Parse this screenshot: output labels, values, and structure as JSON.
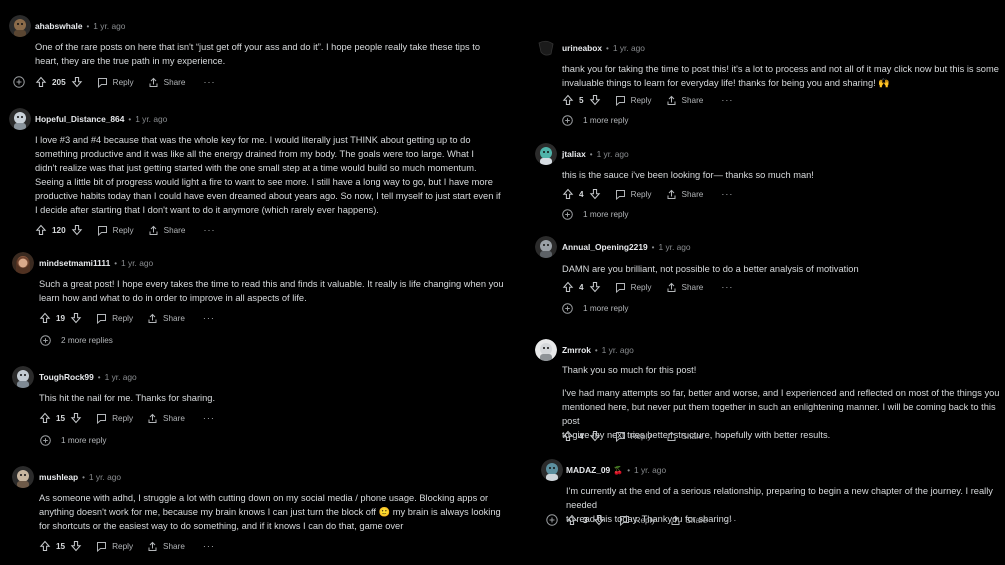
{
  "actions": {
    "reply": "Reply",
    "share": "Share",
    "more": "···"
  },
  "comments": [
    {
      "user": "ahabswhale",
      "time": "1 yr. ago",
      "lines": [
        "One of the rare posts on here that isn't “just get off your ass and do it”. I hope people really take these tips to",
        "heart, they are the true path in my experience."
      ],
      "score": "205",
      "avatar_color": "#8b6b4a"
    },
    {
      "user": "Hopeful_Distance_864",
      "time": "1 yr. ago",
      "lines": [
        "I love #3 and #4 because that was the whole key for me. I would literally just THINK about getting up to do",
        "something productive and it was like all the energy drained from my body. The goals were too large. What I",
        "didn't realize was that just getting started with the one small step at a time would build so much momentum.",
        "Seeing a little bit of progress would light a fire to want to see more. I still have a long way to go, but I have more",
        "productive habits today than I could have even dreamed about years ago. So now, I tell myself to just start even if",
        "I decide after starting that I don't want to do it anymore (which rarely ever happens)."
      ],
      "score": "120",
      "avatar_color": "#c9d1d8"
    },
    {
      "user": "mindsetmami1111",
      "time": "1 yr. ago",
      "lines": [
        "Such a great post! I hope every takes the time to read this and finds it valuable. It really is life changing when you",
        "learn how and what to do in order to improve in all aspects of life."
      ],
      "score": "19",
      "avatar_color": "#a0674a",
      "more_replies": "2 more replies"
    },
    {
      "user": "ToughRock99",
      "time": "1 yr. ago",
      "lines": [
        "This hit the nail for me. Thanks for sharing."
      ],
      "score": "15",
      "avatar_color": "#c3cbd3",
      "more_replies": "1 more reply"
    },
    {
      "user": "mushleap",
      "time": "1 yr. ago",
      "lines": [
        "As someone with adhd, I struggle a lot with cutting down on my social media / phone usage. Blocking apps or",
        "anything doesn't work for me, because my brain knows I can just turn the block off 🙂 my brain is always looking",
        "for shortcuts or the easiest way to do something, and if it knows I can do that, game over"
      ],
      "score": "15",
      "avatar_color": "#6e5a48"
    },
    {
      "user": "urineabox",
      "time": "1 yr. ago",
      "lines": [
        "thank you for taking the time to post this! it's a lot to process and not all of it may click now but this is some",
        "invaluable things to learn for everyday life! thanks for being you and sharing! 🙌"
      ],
      "score": "5",
      "avatar_color": "#1b1b1b",
      "more_replies": "1 more reply"
    },
    {
      "user": "jtaliax",
      "time": "1 yr. ago",
      "lines": [
        "this is the sauce i've been looking for— thanks so much man!"
      ],
      "score": "4",
      "avatar_color": "#4fb3a9",
      "more_replies": "1 more reply"
    },
    {
      "user": "Annual_Opening2219",
      "time": "1 yr. ago",
      "lines": [
        "DAMN are you brilliant, not possible to do a better analysis of motivation"
      ],
      "score": "4",
      "avatar_color": "#9aa0a6",
      "more_replies": "1 more reply"
    },
    {
      "user": "Zmrrok",
      "time": "1 yr. ago",
      "lines": [
        "Thank you so much for this post!",
        "",
        "I've had many attempts so far, better and worse, and I experienced and reflected on most of the things you",
        "mentioned here, but never put them together in such an enlightening manner. I will be coming back to this post",
        "to give my next tries better structure, hopefully with better results."
      ],
      "score": "4",
      "avatar_color": "#d5d8db"
    },
    {
      "user": "MADAZ_09",
      "time": "1 yr. ago",
      "lines": [
        "I'm currently at the end of a serious relationship, preparing to begin a new chapter of the journey. I really needed",
        "to read this today. Thankyou for sharing!"
      ],
      "score": "3",
      "avatar_color": "#5c8f9e"
    }
  ]
}
